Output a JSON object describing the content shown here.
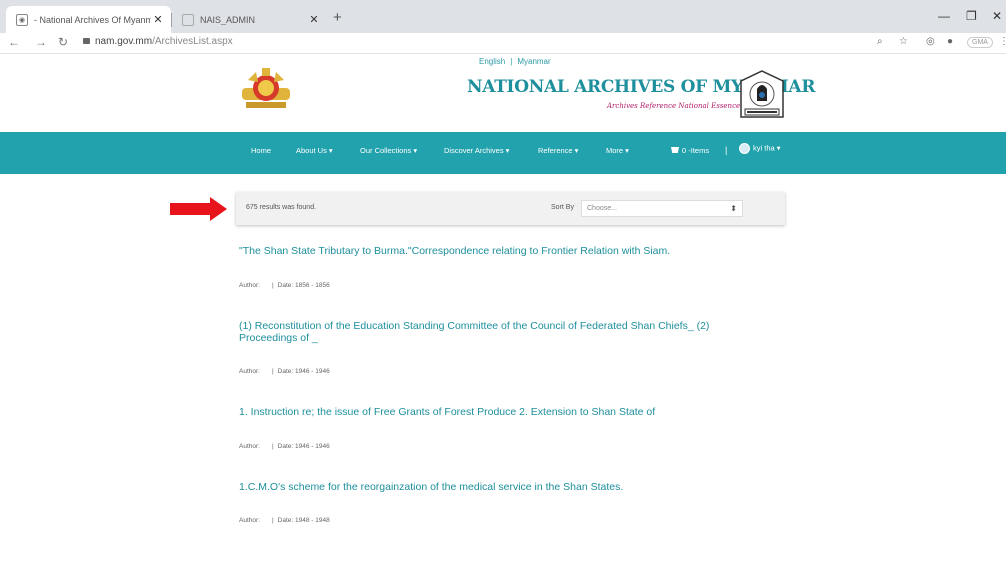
{
  "browser": {
    "tabs": [
      {
        "title": "- National Archives Of Myanmar"
      },
      {
        "title": "NAIS_ADMIN"
      }
    ],
    "url_host": "nam.gov.mm",
    "url_path": "/ArchivesList.aspx",
    "profile_label": "GMA"
  },
  "header": {
    "lang_english": "English",
    "lang_myanmar": "Myanmar",
    "title": "NATIONAL ARCHIVES OF MYANMAR",
    "tagline": "Archives Reference National Essence"
  },
  "menu": {
    "items": [
      "Home",
      "About Us ▾",
      "Our Collections ▾",
      "Discover Archives ▾",
      "Reference ▾",
      "More ▾"
    ],
    "cart_label": "0 -Items",
    "user_label": "kyi tha ▾"
  },
  "results_bar": {
    "count_text": "675 results was found.",
    "sort_label": "Sort By",
    "sort_placeholder": "Choose..."
  },
  "results": [
    {
      "title": "\"The Shan State Tributary to Burma.\"Correspondence relating to Frontier Relation with Siam.",
      "author_label": "Author:",
      "date_label": "Date:",
      "date": "1856 - 1856"
    },
    {
      "title": "(1) Reconstitution of the Education Standing Committee of the Council of Federated Shan Chiefs_ (2) Proceedings of _",
      "author_label": "Author:",
      "date_label": "Date:",
      "date": "1946 - 1946"
    },
    {
      "title": "1. Instruction re; the issue of Free Grants of Forest Produce 2. Extension to Shan State of",
      "author_label": "Author:",
      "date_label": "Date:",
      "date": "1946 - 1946"
    },
    {
      "title": "1.C.M.O's scheme for the reorgainzation of the medical service in the Shan States.",
      "author_label": "Author:",
      "date_label": "Date:",
      "date": "1948 - 1948"
    }
  ],
  "colors": {
    "teal": "#22a2ac",
    "link": "#1d8f9c",
    "arrow": "#e8141b",
    "tagline": "#b3206a"
  }
}
